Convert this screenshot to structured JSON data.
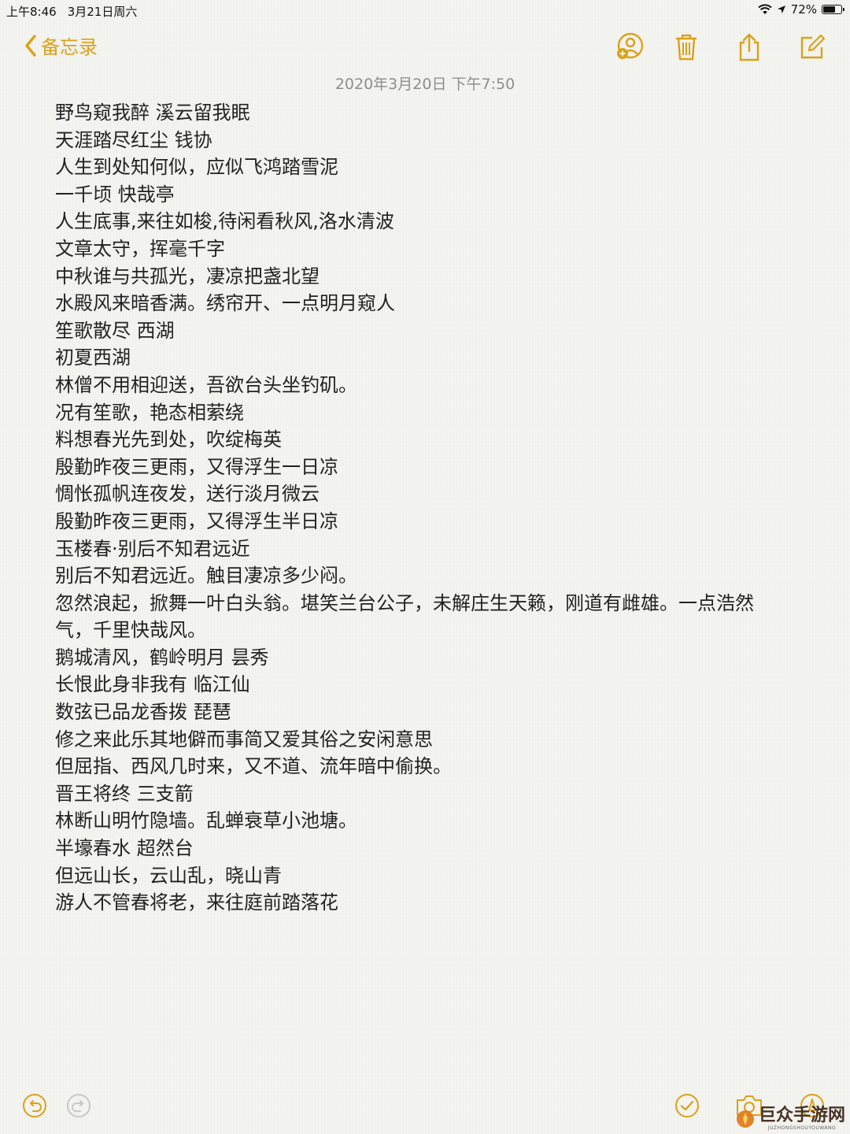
{
  "status_bar": {
    "time": "上午8:46",
    "date": "3月21日周六",
    "battery": "72%",
    "battery_level": 0.72
  },
  "nav": {
    "back_label": "备忘录"
  },
  "note": {
    "date": "2020年3月20日 下午7:50",
    "lines": [
      "野鸟窥我醉 溪云留我眠",
      "天涯踏尽红尘 钱协",
      "人生到处知何似，应似飞鸿踏雪泥",
      "一千顷 快哉亭",
      "人生底事,来往如梭,待闲看秋风,洛水清波",
      "文章太守，挥毫千字",
      "中秋谁与共孤光，凄凉把盏北望",
      "水殿风来暗香满。绣帘开、一点明月窥人",
      "笙歌散尽 西湖",
      "初夏西湖",
      "林僧不用相迎送，吾欲台头坐钓矶。",
      "况有笙歌，艳态相萦绕",
      "料想春光先到处，吹绽梅英",
      "殷勤昨夜三更雨，又得浮生一日凉",
      "惆怅孤帆连夜发，送行淡月微云",
      "殷勤昨夜三更雨，又得浮生半日凉",
      "玉楼春·别后不知君远近",
      "别后不知君远近。触目凄凉多少闷。",
      "忽然浪起，掀舞一叶白头翁。堪笑兰台公子，未解庄生天籁，刚道有雌雄。一点浩然气，千里快哉风。",
      "鹅城清风，鹤岭明月 昙秀",
      "长恨此身非我有  临江仙",
      "数弦已品龙香拨 琵琶",
      "修之来此乐其地僻而事简又爱其俗之安闲意思",
      "但屈指、西风几时来，又不道、流年暗中偷换。",
      "晋王将终 三支箭",
      "林断山明竹隐墙。乱蝉衰草小池塘。",
      "半壕春水 超然台",
      "但远山长，云山乱，晓山青",
      "游人不管春将老，来往庭前踏落花"
    ]
  },
  "icons": {
    "accent_color": "#d9a21b",
    "top": [
      "add-person-icon",
      "trash-icon",
      "share-icon",
      "compose-icon"
    ],
    "bottom": [
      "undo-icon",
      "redo-icon",
      "checklist-icon",
      "camera-icon",
      "markup-icon"
    ]
  },
  "watermark": {
    "main": "巨众手游网",
    "sub": "JUZHONGSHOUYOUWANG"
  }
}
